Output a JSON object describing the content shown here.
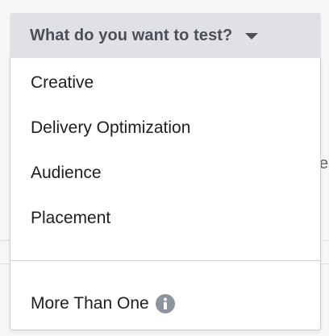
{
  "dropdown": {
    "label": "What do you want to test?",
    "caret_icon": "caret-down-icon"
  },
  "menu": {
    "items": [
      {
        "label": "Creative"
      },
      {
        "label": "Delivery Optimization"
      },
      {
        "label": "Audience"
      },
      {
        "label": "Placement"
      }
    ],
    "extra_item": {
      "label": "More Than One",
      "icon": "info-icon"
    }
  },
  "background": {
    "peek_text": "e"
  },
  "colors": {
    "trigger_bg": "#dfe1e5",
    "text": "#1c1e21",
    "icon": "#8d949e"
  }
}
